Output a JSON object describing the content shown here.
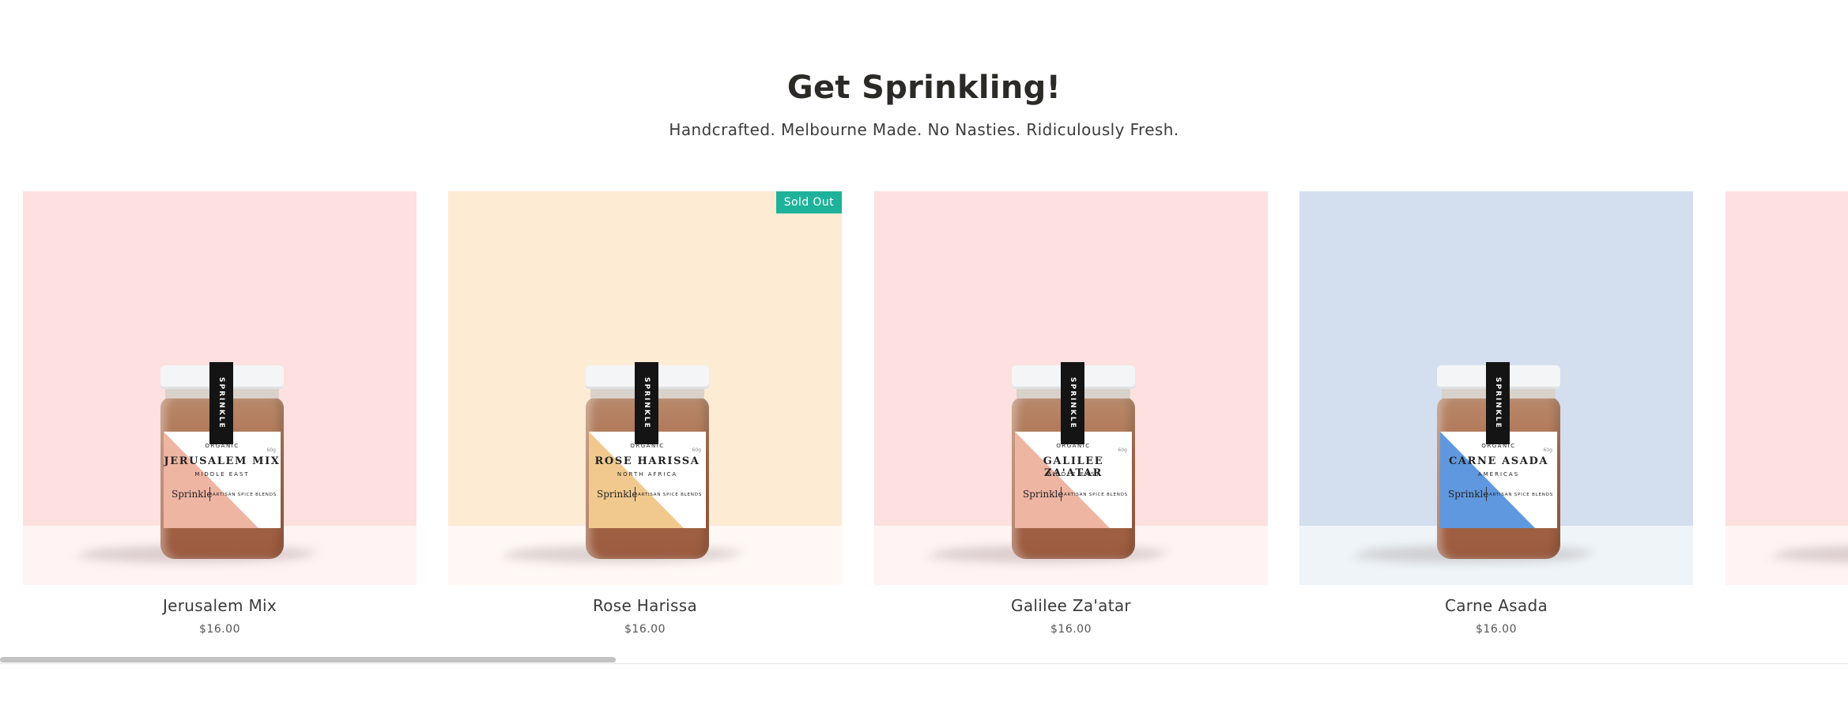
{
  "section": {
    "title": "Get Sprinkling!",
    "subtitle": "Handcrafted. Melbourne Made. No Nasties. Ridiculously Fresh."
  },
  "products": [
    {
      "name": "Jerusalem Mix",
      "price": "$16.00",
      "badge": "",
      "wall_color": "#fde0df",
      "floor_color": "#fff3f3",
      "label_accent": "#efb5a3",
      "label": {
        "organic": "ORGANIC",
        "title": "JERUSALEM MIX",
        "region": "MIDDLE EAST",
        "brand": "Sprinkle",
        "blend": "ARTISAN SPICE BLENDS",
        "tag": "SPRINKLE",
        "grams": "60g"
      }
    },
    {
      "name": "Rose Harissa",
      "price": "$16.00",
      "badge": "Sold Out",
      "wall_color": "#fdebd4",
      "floor_color": "#fff8f5",
      "label_accent": "#f1c98f",
      "label": {
        "organic": "ORGANIC",
        "title": "ROSE HARISSA",
        "region": "NORTH AFRICA",
        "brand": "Sprinkle",
        "blend": "ARTISAN SPICE BLENDS",
        "tag": "SPRINKLE",
        "grams": "60g"
      }
    },
    {
      "name": "Galilee Za'atar",
      "price": "$16.00",
      "badge": "",
      "wall_color": "#fde0df",
      "floor_color": "#fff3f3",
      "label_accent": "#efb5a3",
      "label": {
        "organic": "ORGANIC",
        "title": "GALILEE ZA'ATAR",
        "region": "MIDDLE EAST",
        "brand": "Sprinkle",
        "blend": "ARTISAN SPICE BLENDS",
        "tag": "SPRINKLE",
        "grams": "60g"
      }
    },
    {
      "name": "Carne Asada",
      "price": "$16.00",
      "badge": "",
      "wall_color": "#d3dfee",
      "floor_color": "#eef4f8",
      "label_accent": "#5f98de",
      "label": {
        "organic": "ORGANIC",
        "title": "CARNE ASADA",
        "region": "AMERICAS",
        "brand": "Sprinkle",
        "blend": "ARTISAN SPICE BLENDS",
        "tag": "SPRINKLE",
        "grams": "60g"
      }
    }
  ],
  "partial_card": {
    "wall_color": "#fde0df",
    "floor_color": "#fff3f3"
  },
  "carousel": {
    "scroll_fraction": 0.333
  }
}
